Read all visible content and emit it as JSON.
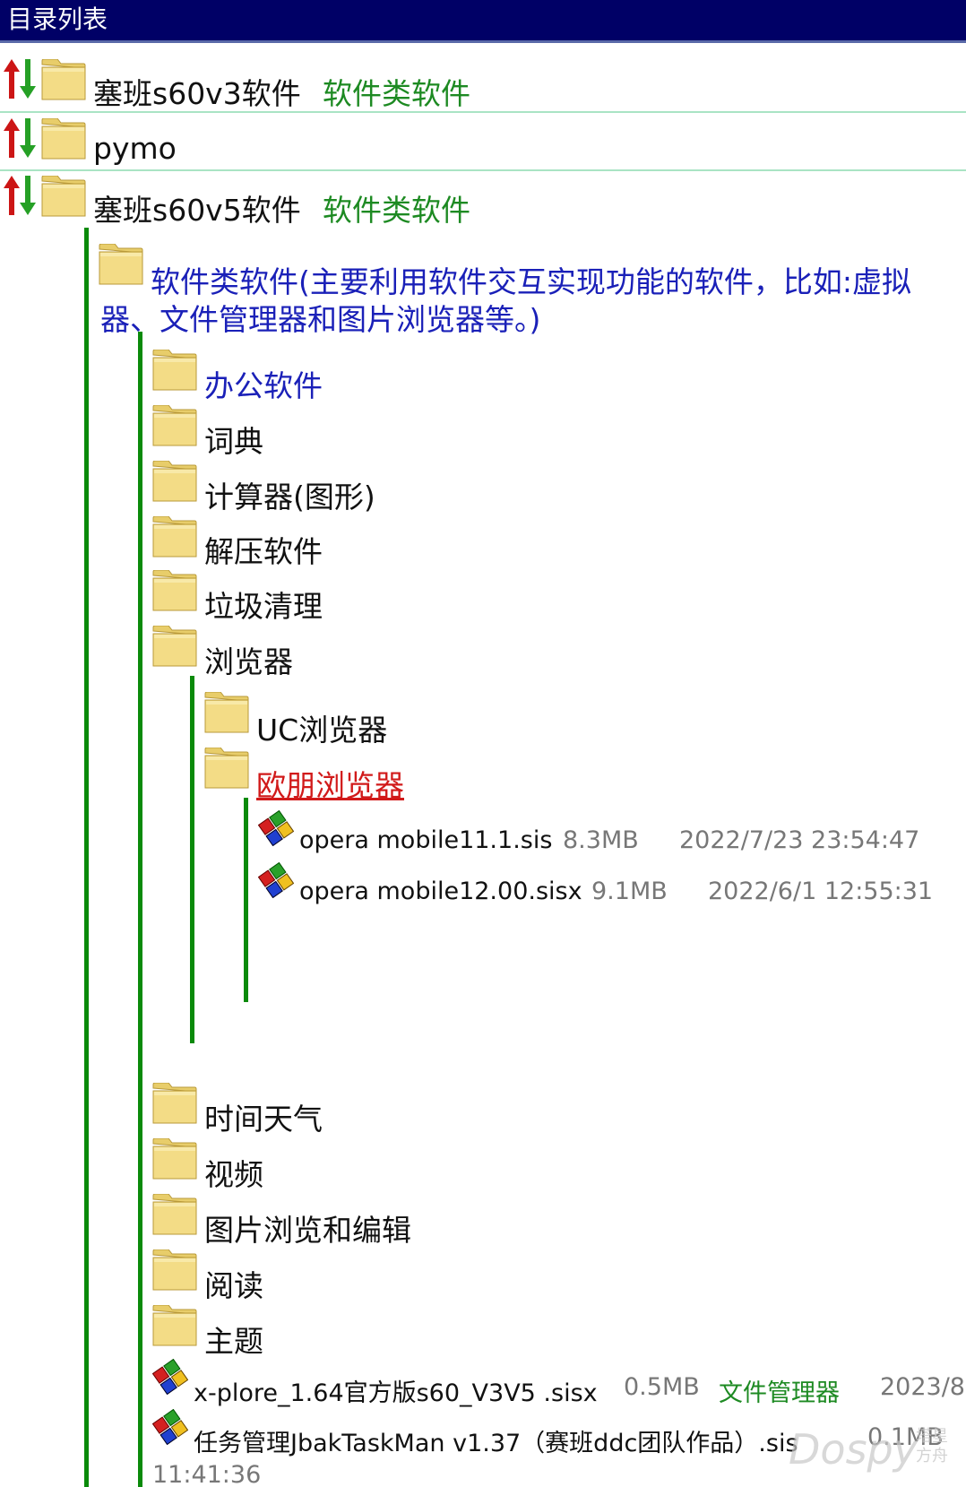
{
  "header": {
    "title": "目录列表"
  },
  "roots": [
    {
      "label": "塞班s60v3软件",
      "category": "软件类软件"
    },
    {
      "label": "pymo",
      "category": ""
    },
    {
      "label": "塞班s60v5软件",
      "category": "软件类软件"
    }
  ],
  "category": {
    "label_line1": "软件类软件(主要利用软件交互实现功能的软件，比如:虚拟",
    "label_line2": "器、文件管理器和图片浏览器等。)"
  },
  "folders": {
    "office": "办公软件",
    "dictionary": "词典",
    "calculator": "计算器(图形)",
    "unzip": "解压软件",
    "cleaner": "垃圾清理",
    "browser": "浏览器",
    "uc_browser": "UC浏览器",
    "opera_browser": "欧朋浏览器",
    "time_weather": "时间天气",
    "video": "视频",
    "image": "图片浏览和编辑",
    "reading": "阅读",
    "theme": "主题"
  },
  "opera_files": [
    {
      "name": "opera mobile11.1.sis",
      "size": "8.3MB",
      "date": "2022/7/23 23:54:47"
    },
    {
      "name": "opera mobile12.00.sisx",
      "size": "9.1MB",
      "date": "2022/6/1 12:55:31"
    }
  ],
  "software_files": [
    {
      "name": "x-plore_1.64官方版s60_V3V5 .sisx",
      "size": "0.5MB",
      "category": "文件管理器",
      "date_part": "2023/8"
    },
    {
      "name": "任务管理JbakTaskMan v1.37（赛班ddc团队作品）.sis",
      "size": "0.1MB",
      "date_tail": "11:41:36"
    }
  ],
  "watermark": {
    "logo": "Dospy",
    "text": "塔星方舟"
  },
  "colors": {
    "header_bg": "#000066",
    "tree_line": "#0a8a0a",
    "link_blue": "#1a20b8",
    "category_green": "#1d8a22",
    "active_red": "#d11a1a"
  },
  "icons": {
    "sort": "sort-arrows-icon",
    "folder": "folder-icon",
    "file": "sis-package-icon"
  }
}
